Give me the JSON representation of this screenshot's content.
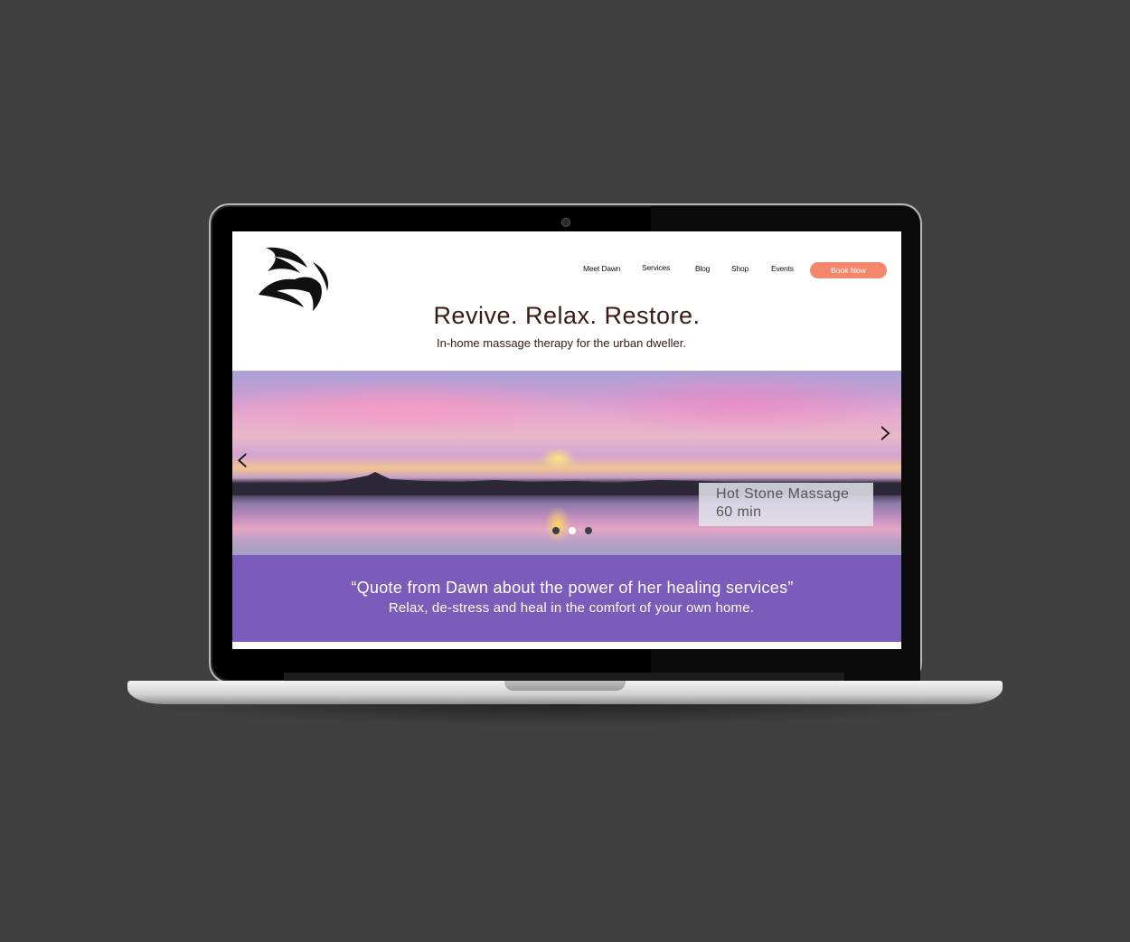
{
  "nav": {
    "items": [
      "Meet Dawn",
      "Services",
      "Blog",
      "Shop",
      "Events"
    ],
    "cta": "Book Now"
  },
  "header": {
    "tagline": "Revive. Relax. Restore.",
    "subtagline": "In-home massage therapy for the urban dweller."
  },
  "hero": {
    "caption_title": "Hot Stone Massage",
    "caption_duration": "60 min",
    "prev_icon": "chevron-left-icon",
    "next_icon": "chevron-right-icon",
    "slides_count": 3,
    "active_slide": 2
  },
  "quote": {
    "text": "“Quote from Dawn about the power of her healing services”",
    "subtext": "Relax, de-stress and heal in the comfort of your own home."
  },
  "colors": {
    "accent_button": "#f4866c",
    "quote_band": "#7b5cba",
    "heading_text": "#3a1a12",
    "background": "#404040"
  }
}
